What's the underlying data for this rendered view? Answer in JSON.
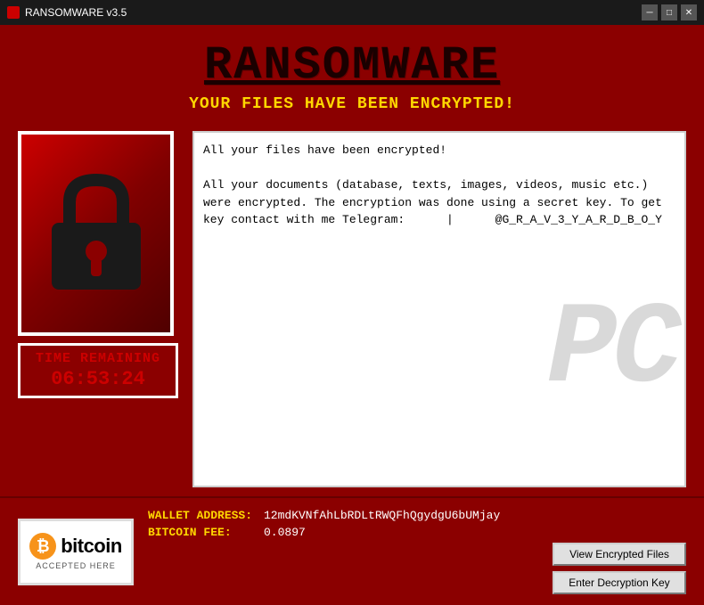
{
  "titlebar": {
    "title": "RANSOMWARE v3.5",
    "controls": {
      "minimize": "─",
      "maximize": "□",
      "close": "✕"
    }
  },
  "header": {
    "title": "RANSOMWARE",
    "subtitle": "YOUR FILES HAVE BEEN ENCRYPTED!"
  },
  "lock": {
    "alt": "Lock icon"
  },
  "timer": {
    "label": "TIME REMAINING",
    "value": "06:53:24"
  },
  "message": {
    "text": "All your files have been encrypted!\n\nAll your documents (database, texts, images, videos, music etc.) were encrypted. The encryption was done using a secret key. To get key contact with me Telegram:      |      @G_R_A_V_3_Y_A_R_D_B_O_Y"
  },
  "watermark": {
    "text": "PC"
  },
  "bitcoin": {
    "symbol": "₿",
    "name": "bitcoin",
    "accepted": "ACCEPTED HERE"
  },
  "wallet": {
    "address_label": "WALLET ADDRESS:",
    "address_value": "12mdKVNfAhLbRDLtRWQFhQgydgU6bUMjay",
    "fee_label": "BITCOIN FEE:",
    "fee_value": "0.0897"
  },
  "buttons": {
    "view_files": "View Encrypted Files",
    "enter_key": "Enter Decryption Key"
  }
}
